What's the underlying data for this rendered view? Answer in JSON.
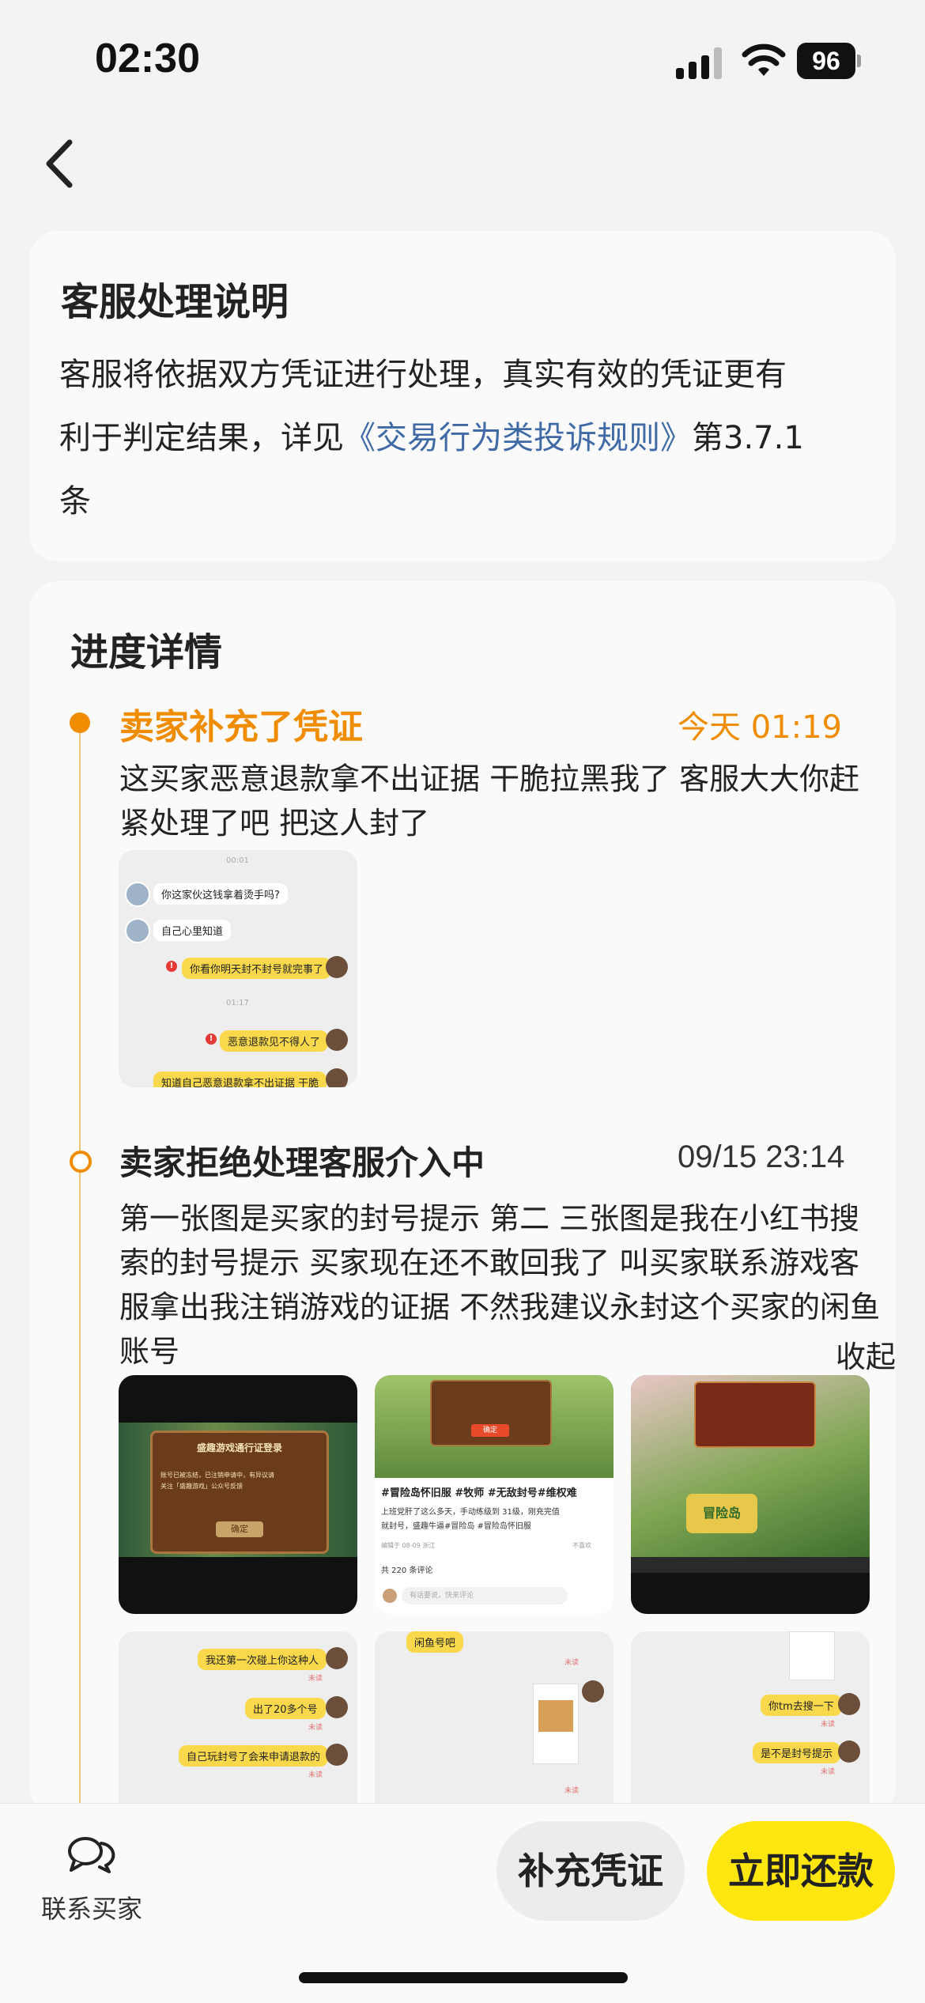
{
  "status_bar": {
    "time": "02:30",
    "battery": "96"
  },
  "notice": {
    "title": "客服处理说明",
    "line1": "客服将依据双方凭证进行处理，真实有效的凭证更有",
    "line2_prefix": "利于判定结果，详见",
    "line2_link": "《交易行为类投诉规则》",
    "line2_suffix": "第3.7.1",
    "line3": "条"
  },
  "progress": {
    "title": "进度详情",
    "events": [
      {
        "title": "卖家补充了凭证",
        "time": "今天 01:19",
        "desc_lines": [
          "这买家恶意退款拿不出证据 干脆拉黑我了 客服大大你赶",
          "紧处理了吧 把这人封了"
        ],
        "chat": {
          "t1": "00:01",
          "m1": "你这家伙这钱拿着烫手吗?",
          "m2": "自己心里知道",
          "m3": "你看你明天封不封号就完事了",
          "t2": "01:17",
          "m4": "恶意退款见不得人了",
          "m5": "知道自己恶意退款拿不出证据 干脆"
        }
      },
      {
        "title": "卖家拒绝处理客服介入中",
        "time": "09/15 23:14",
        "desc_lines": [
          "第一张图是买家的封号提示 第二 三张图是我在小红书搜",
          "索的封号提示 买家现在还不敢回我了 叫买家联系游戏客",
          "服拿出我注销游戏的证据 不然我建议永封这个买家的闲鱼",
          "账号"
        ],
        "collapse": "收起",
        "img1": {
          "dialog_title": "盛趣游戏通行证登录",
          "dialog_text1": "账号已被冻结，已注销申请中，有异议请",
          "dialog_text2": "关注「盛趣游戏」公众号反馈",
          "button": "确定"
        },
        "img2": {
          "hashtags": "#冒险岛怀旧服 #牧师 #无敌封号#维权难",
          "text1": "上班党肝了这么多天，手动练级到 31级，刚充完值",
          "text2": "就封号，盛趣牛逼#冒险岛 #冒险岛怀旧服",
          "meta": "编辑于 08-09 浙江",
          "dislike": "不喜欢",
          "comments": "共 220 条评论",
          "input": "有话要说，快来评论",
          "button": "确定"
        },
        "img3": {
          "logo": "冒险岛"
        },
        "chat_a": {
          "m1": "我还第一次碰上你这种人",
          "m2": "出了20多个号",
          "m3": "自己玩封号了会来申请退款的",
          "unread": "未读"
        },
        "chat_b": {
          "m1": "闲鱼号吧",
          "unread": "未读"
        },
        "chat_c": {
          "m1": "你tm去搜一下",
          "m2": "是不是封号提示",
          "unread": "未读"
        }
      }
    ]
  },
  "bottom_bar": {
    "contact_label": "联系买家",
    "supplement_button": "补充凭证",
    "refund_button": "立即还款"
  }
}
